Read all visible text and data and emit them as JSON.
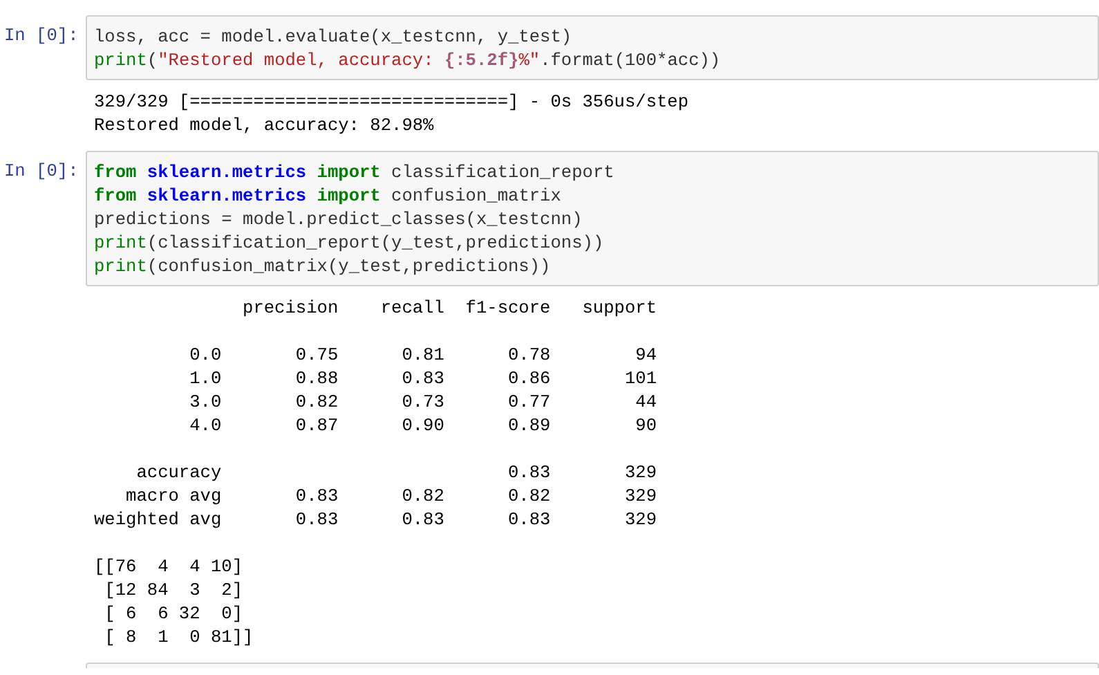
{
  "cells": [
    {
      "kind": "code",
      "prompt": "In [0]:",
      "code": [
        [
          {
            "t": "loss, acc = model.evaluate(x_testcnn, y_test)",
            "kind": "plain"
          }
        ],
        [
          {
            "t": "print",
            "kind": "builtin"
          },
          {
            "t": "(",
            "kind": "plain"
          },
          {
            "t": "\"Restored model, accuracy: ",
            "kind": "string"
          },
          {
            "t": "{:5.2f}",
            "kind": "interp"
          },
          {
            "t": "%\"",
            "kind": "string"
          },
          {
            "t": ".format(100*acc))",
            "kind": "plain"
          }
        ]
      ],
      "output": [
        [
          "329/329 [==============================] - 0s 356us/step",
          "Restored model, accuracy: 82.98%"
        ]
      ]
    },
    {
      "kind": "code",
      "prompt": "In [0]:",
      "code": [
        [
          {
            "t": "from",
            "kind": "keyword"
          },
          {
            "t": " sklearn.metrics ",
            "kind": "module"
          },
          {
            "t": "import",
            "kind": "keyword"
          },
          {
            "t": " classification_report",
            "kind": "plain"
          }
        ],
        [
          {
            "t": "from",
            "kind": "keyword"
          },
          {
            "t": " sklearn.metrics ",
            "kind": "module"
          },
          {
            "t": "import",
            "kind": "keyword"
          },
          {
            "t": " confusion_matrix",
            "kind": "plain"
          }
        ],
        [
          {
            "t": "predictions = model.predict_classes(x_testcnn)",
            "kind": "plain"
          }
        ],
        [
          {
            "t": "print",
            "kind": "builtin"
          },
          {
            "t": "(classification_report(y_test,predictions))",
            "kind": "plain"
          }
        ],
        [
          {
            "t": "print",
            "kind": "builtin"
          },
          {
            "t": "(confusion_matrix(y_test,predictions))",
            "kind": "plain"
          }
        ]
      ],
      "output": [
        [
          "              precision    recall  f1-score   support"
        ],
        [
          "         0.0       0.75      0.81      0.78        94",
          "         1.0       0.88      0.83      0.86       101",
          "         3.0       0.82      0.73      0.77        44",
          "         4.0       0.87      0.90      0.89        90"
        ],
        [
          "    accuracy                           0.83       329",
          "   macro avg       0.83      0.82      0.82       329",
          "weighted avg       0.83      0.83      0.83       329"
        ],
        [
          "[[76  4  4 10]",
          " [12 84  3  2]",
          " [ 6  6 32  0]",
          " [ 8  1  0 81]]"
        ]
      ]
    },
    {
      "kind": "empty"
    }
  ]
}
